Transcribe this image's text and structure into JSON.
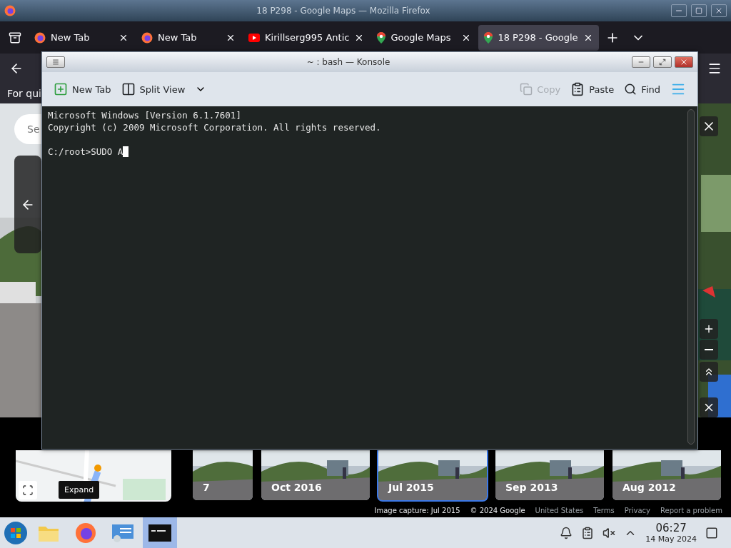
{
  "firefox": {
    "title": "18 P298 - Google Maps — Mozilla Firefox",
    "tabs": [
      {
        "label": "New Tab",
        "kind": "firefox",
        "selected": false
      },
      {
        "label": "New Tab",
        "kind": "firefox",
        "selected": false
      },
      {
        "label": "Kirillserg995 Antic",
        "kind": "video",
        "selected": false
      },
      {
        "label": "Google Maps",
        "kind": "map",
        "selected": false
      },
      {
        "label": "18 P298 - Google",
        "kind": "map",
        "selected": true
      }
    ],
    "notice": "For qui"
  },
  "street_view": {
    "search_placeholder": "Se",
    "expand_tooltip": "Expand",
    "thumbnails": [
      {
        "label": "7",
        "selected": false
      },
      {
        "label": "Oct 2016",
        "selected": false
      },
      {
        "label": "Jul 2015",
        "selected": true
      },
      {
        "label": "Sep 2013",
        "selected": false
      },
      {
        "label": "Aug 2012",
        "selected": false
      }
    ],
    "footer": [
      "Image capture: Jul 2015",
      "© 2024 Google",
      "United States",
      "Terms",
      "Privacy",
      "Report a problem"
    ]
  },
  "konsole": {
    "title": "~ : bash — Konsole",
    "left_actions": [
      {
        "label": "New Tab",
        "kind": "new-tab",
        "disabled": false
      },
      {
        "label": "Split View",
        "kind": "split",
        "disabled": false
      }
    ],
    "right_actions": [
      {
        "label": "Copy",
        "kind": "copy",
        "disabled": true
      },
      {
        "label": "Paste",
        "kind": "paste",
        "disabled": false
      },
      {
        "label": "Find",
        "kind": "find",
        "disabled": false
      }
    ],
    "lines": [
      "Microsoft Windows [Version 6.1.7601]",
      "Copyright (c) 2009 Microsoft Corporation. All rights reserved."
    ],
    "prompt": "C:/root>SUDO A"
  },
  "taskbar": {
    "apps": [
      {
        "kind": "files",
        "selected": false
      },
      {
        "kind": "firefox",
        "selected": false
      },
      {
        "kind": "control",
        "selected": false
      },
      {
        "kind": "terminal",
        "selected": true
      }
    ],
    "time": "06:27",
    "date": "14 May 2024"
  }
}
